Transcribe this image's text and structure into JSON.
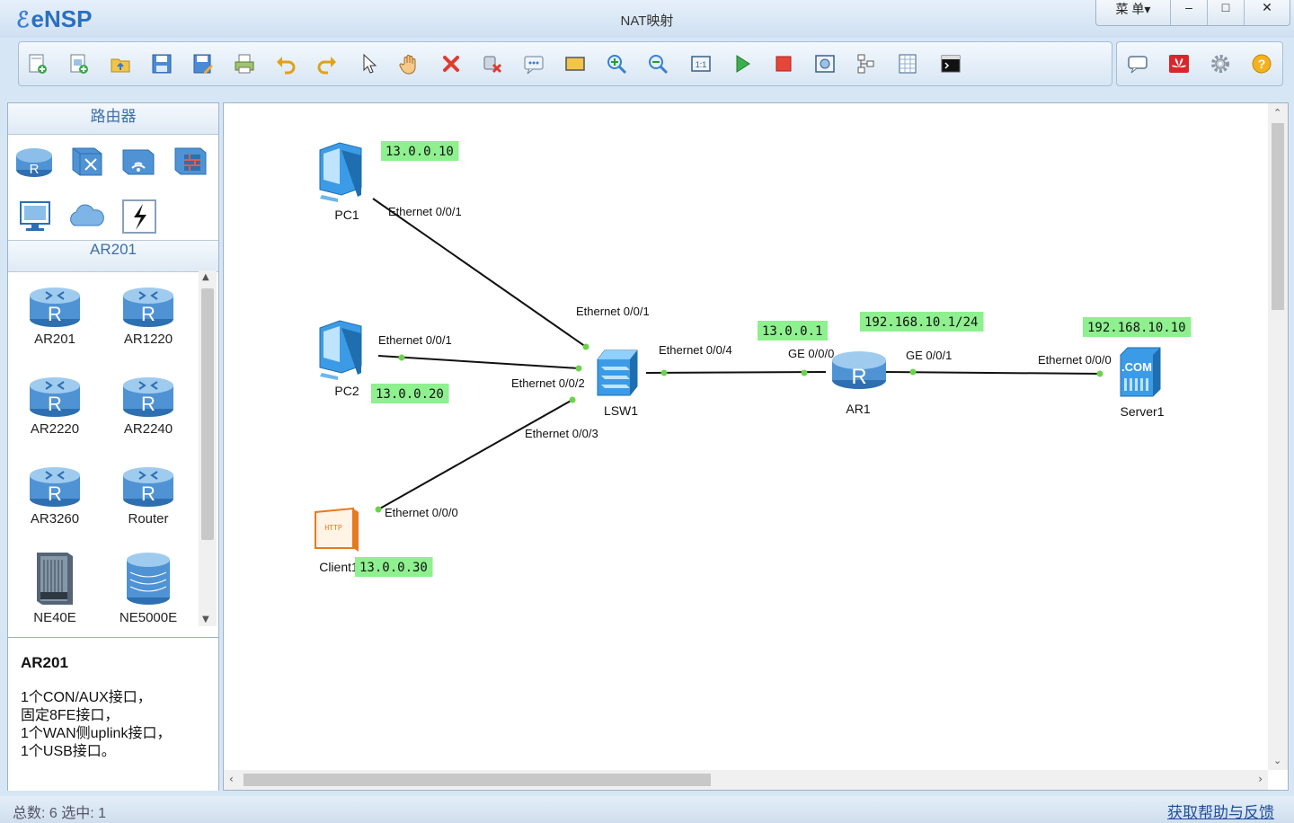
{
  "app": {
    "logo": "eNSP",
    "title": "NAT映射"
  },
  "window_buttons": {
    "menu": "菜 单▾",
    "minimize": "–",
    "maximize": "□",
    "close": "✕"
  },
  "toolbar": {
    "items": [
      "new-topology",
      "new-device",
      "open",
      "save",
      "save-as",
      "print",
      "undo",
      "redo",
      "select",
      "pan",
      "delete",
      "delete-link",
      "text",
      "rectangle",
      "zoom-in",
      "zoom-out",
      "fit-view",
      "start-all",
      "stop-all",
      "capture",
      "topology",
      "grid",
      "terminal"
    ],
    "right_items": [
      "chat",
      "huawei",
      "settings",
      "help"
    ]
  },
  "left_panel": {
    "section_title": "路由器",
    "category_icons": [
      "router-category",
      "switch-category",
      "wireless-category",
      "firewall-category",
      "pc-category",
      "cloud-category",
      "link-category"
    ],
    "subsection_title": "AR201",
    "devices": [
      {
        "name": "AR201",
        "icon": "router"
      },
      {
        "name": "AR1220",
        "icon": "router"
      },
      {
        "name": "AR2220",
        "icon": "router"
      },
      {
        "name": "AR2240",
        "icon": "router"
      },
      {
        "name": "AR3260",
        "icon": "router"
      },
      {
        "name": "Router",
        "icon": "router"
      },
      {
        "name": "NE40E",
        "icon": "chassis"
      },
      {
        "name": "NE5000E",
        "icon": "core-router"
      }
    ],
    "description": {
      "title": "AR201",
      "lines": [
        "1个CON/AUX接口，",
        "固定8FE接口，",
        "1个WAN侧uplink接口，",
        "1个USB接口。"
      ]
    }
  },
  "topology": {
    "nodes": [
      {
        "id": "PC1",
        "label": "PC1",
        "type": "pc",
        "ip": "13.0.0.10"
      },
      {
        "id": "PC2",
        "label": "PC2",
        "type": "pc",
        "ip": "13.0.0.20"
      },
      {
        "id": "Client1",
        "label": "Client1",
        "type": "client",
        "ip": "13.0.0.30"
      },
      {
        "id": "LSW1",
        "label": "LSW1",
        "type": "switch"
      },
      {
        "id": "AR1",
        "label": "AR1",
        "type": "router",
        "ips": [
          "13.0.0.1",
          "192.168.10.1/24"
        ]
      },
      {
        "id": "Server1",
        "label": "Server1",
        "type": "server",
        "ip": "192.168.10.10"
      }
    ],
    "links": [
      {
        "a": "PC1",
        "a_port": "Ethernet 0/0/1",
        "b": "LSW1",
        "b_port": "Ethernet 0/0/1"
      },
      {
        "a": "PC2",
        "a_port": "Ethernet 0/0/1",
        "b": "LSW1",
        "b_port": "Ethernet 0/0/2"
      },
      {
        "a": "Client1",
        "a_port": "Ethernet 0/0/0",
        "b": "LSW1",
        "b_port": "Ethernet 0/0/3"
      },
      {
        "a": "LSW1",
        "a_port": "Ethernet 0/0/4",
        "b": "AR1",
        "b_port": "GE 0/0/0"
      },
      {
        "a": "AR1",
        "a_port": "GE 0/0/1",
        "b": "Server1",
        "b_port": "Ethernet 0/0/0"
      }
    ],
    "ip_label_color": "#8ef08e",
    "link_dot_color": "#6cd44a"
  },
  "status": {
    "left": "总数: 6  选中: 1",
    "right": "获取帮助与反馈"
  }
}
